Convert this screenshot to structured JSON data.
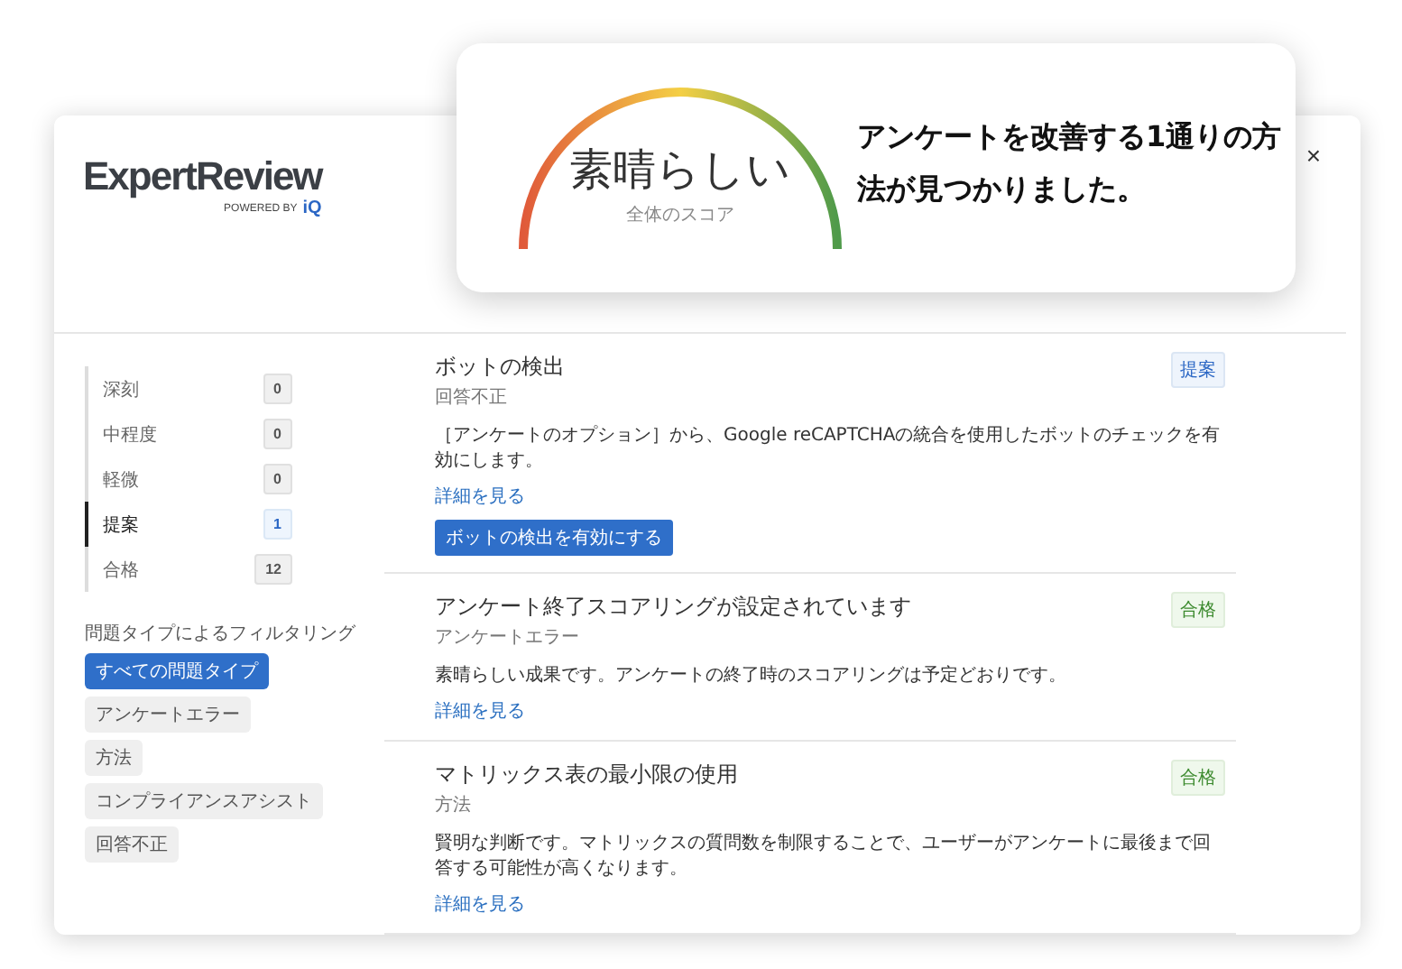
{
  "logo": {
    "name": "ExpertReview",
    "tagline": "POWERED BY",
    "brand": "iQ"
  },
  "close": "×",
  "score": {
    "label": "素晴らしい",
    "caption": "全体のスコア"
  },
  "headline": "アンケートを改善する**1**通りの方法が見つかりました。",
  "severity": [
    {
      "label": "深刻",
      "count": "0",
      "selected": false
    },
    {
      "label": "中程度",
      "count": "0",
      "selected": false
    },
    {
      "label": "軽微",
      "count": "0",
      "selected": false
    },
    {
      "label": "提案",
      "count": "1",
      "selected": true
    },
    {
      "label": "合格",
      "count": "12",
      "selected": false
    }
  ],
  "filter_title": "問題タイプによるフィルタリング",
  "filters": [
    {
      "label": "すべての問題タイプ",
      "selected": true
    },
    {
      "label": "アンケートエラー",
      "selected": false
    },
    {
      "label": "方法",
      "selected": false
    },
    {
      "label": "コンプライアンスアシスト",
      "selected": false
    },
    {
      "label": "回答不正",
      "selected": false
    }
  ],
  "results": [
    {
      "title": "ボットの検出",
      "category": "回答不正",
      "badge": "提案",
      "kind": "suggestion",
      "description": "［アンケートのオプション］から、Google reCAPTCHAの統合を使用したボットのチェックを有効にします。",
      "link": "詳細を見る",
      "action": "ボットの検出を有効にする"
    },
    {
      "title": "アンケート終了スコアリングが設定されています",
      "category": "アンケートエラー",
      "badge": "合格",
      "kind": "pass",
      "description": "素晴らしい成果です。アンケートの終了時のスコアリングは予定どおりです。",
      "link": "詳細を見る"
    },
    {
      "title": "マトリックス表の最小限の使用",
      "category": "方法",
      "badge": "合格",
      "kind": "pass",
      "description": "賢明な判断です。マトリックスの質問数を制限することで、ユーザーがアンケートに最後まで回答する可能性が高くなります。",
      "link": "詳細を見る"
    }
  ]
}
